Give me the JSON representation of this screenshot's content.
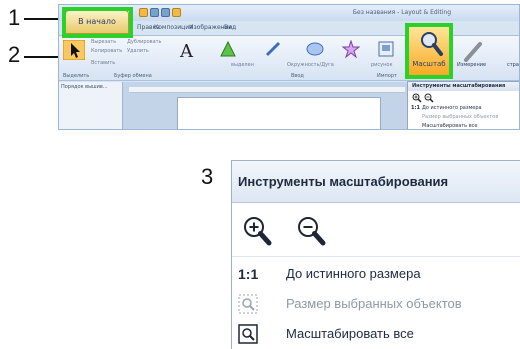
{
  "callouts": {
    "c1": "1",
    "c2": "2",
    "c3": "3"
  },
  "window": {
    "title": "Без названия - Layout & Editing"
  },
  "tabs": {
    "home": "В начало",
    "items": [
      "Правка",
      "Композиция",
      "Изображение",
      "Вид"
    ]
  },
  "ribbon": {
    "clipboard": {
      "cut": "Вырезать",
      "copy": "Копировать",
      "duplicate": "Дублировать",
      "delete": "Удалить",
      "paste": "Вставить"
    },
    "groups": {
      "select": "Выделить",
      "clipboard": "Буфер обмена",
      "input": "Ввод",
      "import": "Импорт"
    },
    "inputs": {
      "shapes": "выделен",
      "circles": "Окружность/Дуга",
      "drawing": "рисунок"
    },
    "zoom_label": "Масштаб",
    "measure": "Измерение",
    "right_edge": "стра"
  },
  "side_panel": {
    "title": "Порядок вышив..."
  },
  "zoom_menu": {
    "title": "Инструменты масштабирования",
    "zoom_in_icon": "zoom-in-icon",
    "zoom_out_icon": "zoom-out-icon",
    "items": [
      {
        "key": "1:1",
        "label": "До истинного размера",
        "enabled": true
      },
      {
        "icon": "zoom-selection-icon",
        "label": "Размер выбранных объектов",
        "enabled": false
      },
      {
        "icon": "zoom-fit-all-icon",
        "label": "Масштабировать все",
        "enabled": true
      }
    ]
  },
  "colors": {
    "highlight": "#2bd12b",
    "zoom_button": "#f8a723",
    "ribbon": "#d6e3f3"
  }
}
